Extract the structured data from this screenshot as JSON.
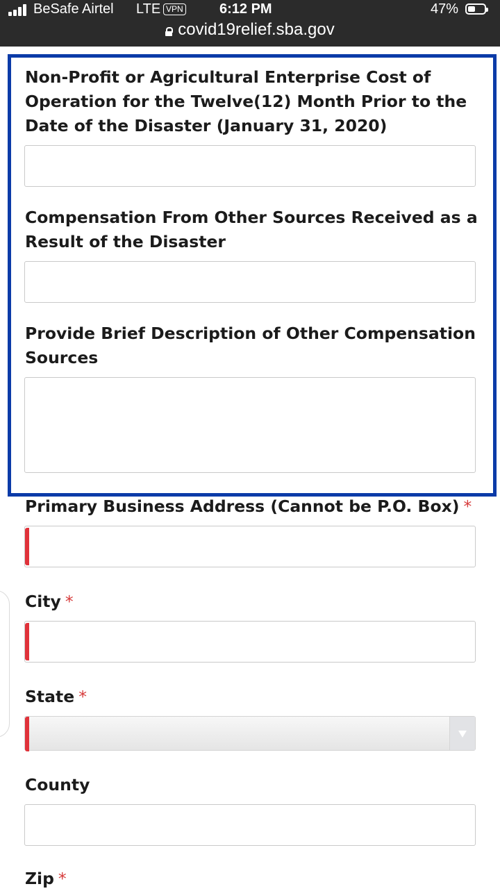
{
  "status_bar": {
    "carrier": "BeSafe Airtel",
    "network": "LTE",
    "vpn_badge": "VPN",
    "time": "6:12 PM",
    "battery_percent": "47%",
    "battery_level": 0.47
  },
  "browser": {
    "url": "covid19relief.sba.gov"
  },
  "form": {
    "highlighted_fields": [
      {
        "label": "Non-Profit or Agricultural Enterprise Cost of Operation for the Twelve(12) Month Prior to the Date of the Disaster (January 31, 2020)",
        "value": ""
      },
      {
        "label": "Compensation From Other Sources Received as a Result of the Disaster",
        "value": ""
      },
      {
        "label": "Provide Brief Description of Other Compensation Sources",
        "value": ""
      }
    ],
    "address": {
      "label": "Primary Business Address (Cannot be P.O. Box)",
      "required_mark": "*",
      "value": ""
    },
    "city": {
      "label": "City",
      "required_mark": "*",
      "value": ""
    },
    "state": {
      "label": "State",
      "required_mark": "*",
      "selected": ""
    },
    "county": {
      "label": "County",
      "value": ""
    },
    "zip": {
      "label": "Zip",
      "required_mark": "*"
    }
  },
  "colors": {
    "highlight_border": "#0b3ba8",
    "required": "#d63a3a",
    "error_bar": "#e0323a",
    "status_bar_bg": "#2b2b2b"
  }
}
